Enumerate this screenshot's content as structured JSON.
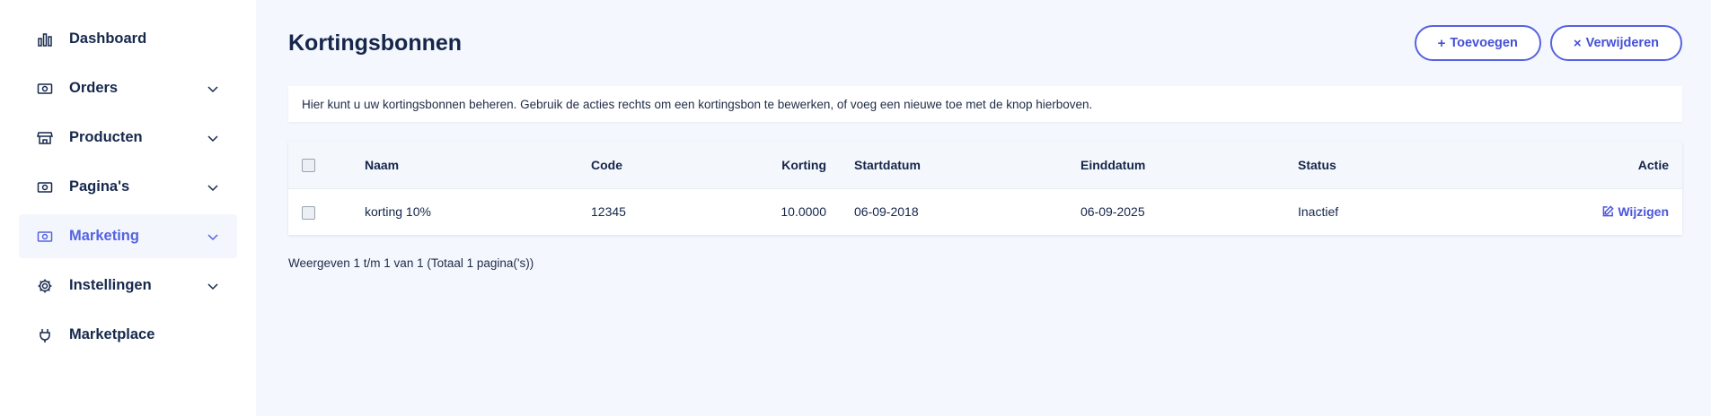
{
  "sidebar": {
    "items": [
      {
        "label": "Dashboard",
        "icon": "bar-chart-icon",
        "expandable": false,
        "active": false
      },
      {
        "label": "Orders",
        "icon": "money-icon",
        "expandable": true,
        "active": false
      },
      {
        "label": "Producten",
        "icon": "store-icon",
        "expandable": true,
        "active": false
      },
      {
        "label": "Pagina's",
        "icon": "money-icon",
        "expandable": true,
        "active": false
      },
      {
        "label": "Marketing",
        "icon": "money-icon",
        "expandable": true,
        "active": true
      },
      {
        "label": "Instellingen",
        "icon": "gear-icon",
        "expandable": true,
        "active": false
      },
      {
        "label": "Marketplace",
        "icon": "plug-icon",
        "expandable": false,
        "active": false
      }
    ]
  },
  "header": {
    "title": "Kortingsbonnen",
    "add_label": "Toevoegen",
    "delete_label": "Verwijderen"
  },
  "info_text": "Hier kunt u uw kortingsbonnen beheren. Gebruik de acties rechts om een kortingsbon te bewerken, of voeg een nieuwe toe met de knop hierboven.",
  "table": {
    "columns": [
      "Naam",
      "Code",
      "Korting",
      "Startdatum",
      "Einddatum",
      "Status",
      "Actie"
    ],
    "rows": [
      {
        "naam": "korting 10%",
        "code": "12345",
        "korting": "10.0000",
        "startdatum": "06-09-2018",
        "einddatum": "06-09-2025",
        "status": "Inactief",
        "actie": "Wijzigen"
      }
    ]
  },
  "pagination_text": "Weergeven 1 t/m 1 van 1 (Totaal 1 pagina('s))",
  "colors": {
    "accent": "#5563e0",
    "sidebar_bg": "#ffffff",
    "page_bg": "#f4f7fd",
    "text": "#15264a"
  }
}
